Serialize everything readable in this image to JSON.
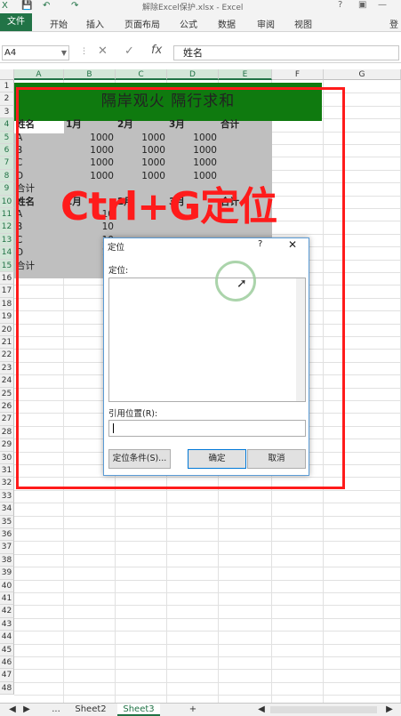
{
  "window": {
    "title": "解除Excel保护.xlsx - Excel",
    "login": "登"
  },
  "ribbon": {
    "tabs": [
      "文件",
      "开始",
      "插入",
      "页面布局",
      "公式",
      "数据",
      "审阅",
      "视图"
    ]
  },
  "formula_bar": {
    "name_box": "A4",
    "fx": "fx",
    "value": "姓名"
  },
  "columns": [
    "A",
    "B",
    "C",
    "D",
    "E",
    "F",
    "G"
  ],
  "rows": [
    "1",
    "2",
    "3",
    "4",
    "5",
    "6",
    "7",
    "8",
    "9",
    "10",
    "11",
    "12",
    "13",
    "14",
    "15",
    "16",
    "17",
    "18",
    "19",
    "20",
    "21",
    "22",
    "23",
    "24",
    "25",
    "26",
    "27",
    "28",
    "29",
    "30",
    "31",
    "32",
    "33",
    "34",
    "35",
    "36",
    "37",
    "38",
    "39",
    "40",
    "41",
    "42",
    "43",
    "44",
    "45",
    "46",
    "47",
    "48"
  ],
  "sheet": {
    "title": "隔岸观火 隔行求和",
    "header1": [
      "姓名",
      "1月",
      "2月",
      "3月",
      "合计"
    ],
    "block1": [
      [
        "A",
        "1000",
        "1000",
        "1000"
      ],
      [
        "B",
        "1000",
        "1000",
        "1000"
      ],
      [
        "C",
        "1000",
        "1000",
        "1000"
      ],
      [
        "D",
        "1000",
        "1000",
        "1000"
      ]
    ],
    "total1": "合计",
    "header2": [
      "姓名",
      "1月",
      "2月",
      "3月",
      "合计"
    ],
    "block2": [
      [
        "A",
        "10",
        "",
        ""
      ],
      [
        "B",
        "10",
        "",
        ""
      ],
      [
        "C",
        "10",
        "",
        ""
      ],
      [
        "D",
        "10",
        "",
        ""
      ]
    ],
    "total2": "合计"
  },
  "overlay_text": "Ctrl+G定位",
  "dialog": {
    "title": "定位",
    "help": "?",
    "close": "✕",
    "goto_label": "定位:",
    "ref_label": "引用位置(R):",
    "ref_value": "",
    "special_button": "定位条件(S)...",
    "ok_button": "确定",
    "cancel_button": "取消"
  },
  "sheet_tabs": {
    "nav_more": "...",
    "tabs": [
      "Sheet2",
      "Sheet3"
    ],
    "active": "Sheet3",
    "add": "+"
  },
  "colors": {
    "excel_green": "#217346",
    "title_fill": "#0f7a0f",
    "range_grey": "#bfbfbf",
    "annotation_red": "#ff1b1b"
  }
}
